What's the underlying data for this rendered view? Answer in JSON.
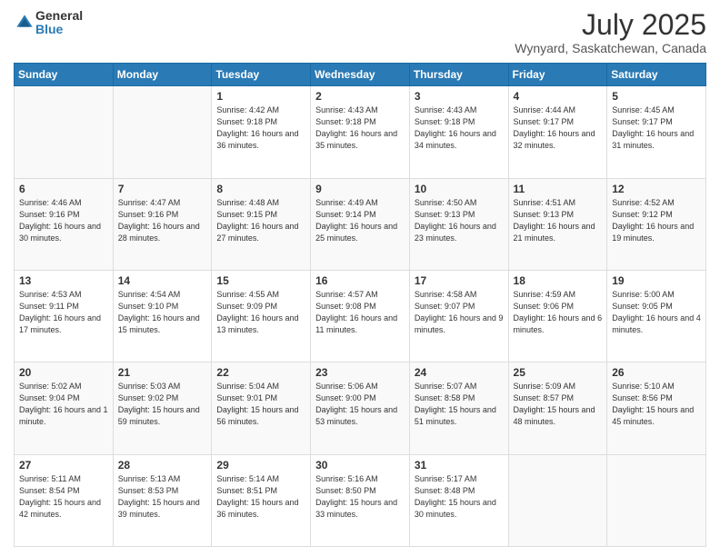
{
  "logo": {
    "general": "General",
    "blue": "Blue"
  },
  "title": "July 2025",
  "subtitle": "Wynyard, Saskatchewan, Canada",
  "days_of_week": [
    "Sunday",
    "Monday",
    "Tuesday",
    "Wednesday",
    "Thursday",
    "Friday",
    "Saturday"
  ],
  "weeks": [
    [
      {
        "day": "",
        "info": ""
      },
      {
        "day": "",
        "info": ""
      },
      {
        "day": "1",
        "info": "Sunrise: 4:42 AM\nSunset: 9:18 PM\nDaylight: 16 hours and 36 minutes."
      },
      {
        "day": "2",
        "info": "Sunrise: 4:43 AM\nSunset: 9:18 PM\nDaylight: 16 hours and 35 minutes."
      },
      {
        "day": "3",
        "info": "Sunrise: 4:43 AM\nSunset: 9:18 PM\nDaylight: 16 hours and 34 minutes."
      },
      {
        "day": "4",
        "info": "Sunrise: 4:44 AM\nSunset: 9:17 PM\nDaylight: 16 hours and 32 minutes."
      },
      {
        "day": "5",
        "info": "Sunrise: 4:45 AM\nSunset: 9:17 PM\nDaylight: 16 hours and 31 minutes."
      }
    ],
    [
      {
        "day": "6",
        "info": "Sunrise: 4:46 AM\nSunset: 9:16 PM\nDaylight: 16 hours and 30 minutes."
      },
      {
        "day": "7",
        "info": "Sunrise: 4:47 AM\nSunset: 9:16 PM\nDaylight: 16 hours and 28 minutes."
      },
      {
        "day": "8",
        "info": "Sunrise: 4:48 AM\nSunset: 9:15 PM\nDaylight: 16 hours and 27 minutes."
      },
      {
        "day": "9",
        "info": "Sunrise: 4:49 AM\nSunset: 9:14 PM\nDaylight: 16 hours and 25 minutes."
      },
      {
        "day": "10",
        "info": "Sunrise: 4:50 AM\nSunset: 9:13 PM\nDaylight: 16 hours and 23 minutes."
      },
      {
        "day": "11",
        "info": "Sunrise: 4:51 AM\nSunset: 9:13 PM\nDaylight: 16 hours and 21 minutes."
      },
      {
        "day": "12",
        "info": "Sunrise: 4:52 AM\nSunset: 9:12 PM\nDaylight: 16 hours and 19 minutes."
      }
    ],
    [
      {
        "day": "13",
        "info": "Sunrise: 4:53 AM\nSunset: 9:11 PM\nDaylight: 16 hours and 17 minutes."
      },
      {
        "day": "14",
        "info": "Sunrise: 4:54 AM\nSunset: 9:10 PM\nDaylight: 16 hours and 15 minutes."
      },
      {
        "day": "15",
        "info": "Sunrise: 4:55 AM\nSunset: 9:09 PM\nDaylight: 16 hours and 13 minutes."
      },
      {
        "day": "16",
        "info": "Sunrise: 4:57 AM\nSunset: 9:08 PM\nDaylight: 16 hours and 11 minutes."
      },
      {
        "day": "17",
        "info": "Sunrise: 4:58 AM\nSunset: 9:07 PM\nDaylight: 16 hours and 9 minutes."
      },
      {
        "day": "18",
        "info": "Sunrise: 4:59 AM\nSunset: 9:06 PM\nDaylight: 16 hours and 6 minutes."
      },
      {
        "day": "19",
        "info": "Sunrise: 5:00 AM\nSunset: 9:05 PM\nDaylight: 16 hours and 4 minutes."
      }
    ],
    [
      {
        "day": "20",
        "info": "Sunrise: 5:02 AM\nSunset: 9:04 PM\nDaylight: 16 hours and 1 minute."
      },
      {
        "day": "21",
        "info": "Sunrise: 5:03 AM\nSunset: 9:02 PM\nDaylight: 15 hours and 59 minutes."
      },
      {
        "day": "22",
        "info": "Sunrise: 5:04 AM\nSunset: 9:01 PM\nDaylight: 15 hours and 56 minutes."
      },
      {
        "day": "23",
        "info": "Sunrise: 5:06 AM\nSunset: 9:00 PM\nDaylight: 15 hours and 53 minutes."
      },
      {
        "day": "24",
        "info": "Sunrise: 5:07 AM\nSunset: 8:58 PM\nDaylight: 15 hours and 51 minutes."
      },
      {
        "day": "25",
        "info": "Sunrise: 5:09 AM\nSunset: 8:57 PM\nDaylight: 15 hours and 48 minutes."
      },
      {
        "day": "26",
        "info": "Sunrise: 5:10 AM\nSunset: 8:56 PM\nDaylight: 15 hours and 45 minutes."
      }
    ],
    [
      {
        "day": "27",
        "info": "Sunrise: 5:11 AM\nSunset: 8:54 PM\nDaylight: 15 hours and 42 minutes."
      },
      {
        "day": "28",
        "info": "Sunrise: 5:13 AM\nSunset: 8:53 PM\nDaylight: 15 hours and 39 minutes."
      },
      {
        "day": "29",
        "info": "Sunrise: 5:14 AM\nSunset: 8:51 PM\nDaylight: 15 hours and 36 minutes."
      },
      {
        "day": "30",
        "info": "Sunrise: 5:16 AM\nSunset: 8:50 PM\nDaylight: 15 hours and 33 minutes."
      },
      {
        "day": "31",
        "info": "Sunrise: 5:17 AM\nSunset: 8:48 PM\nDaylight: 15 hours and 30 minutes."
      },
      {
        "day": "",
        "info": ""
      },
      {
        "day": "",
        "info": ""
      }
    ]
  ]
}
